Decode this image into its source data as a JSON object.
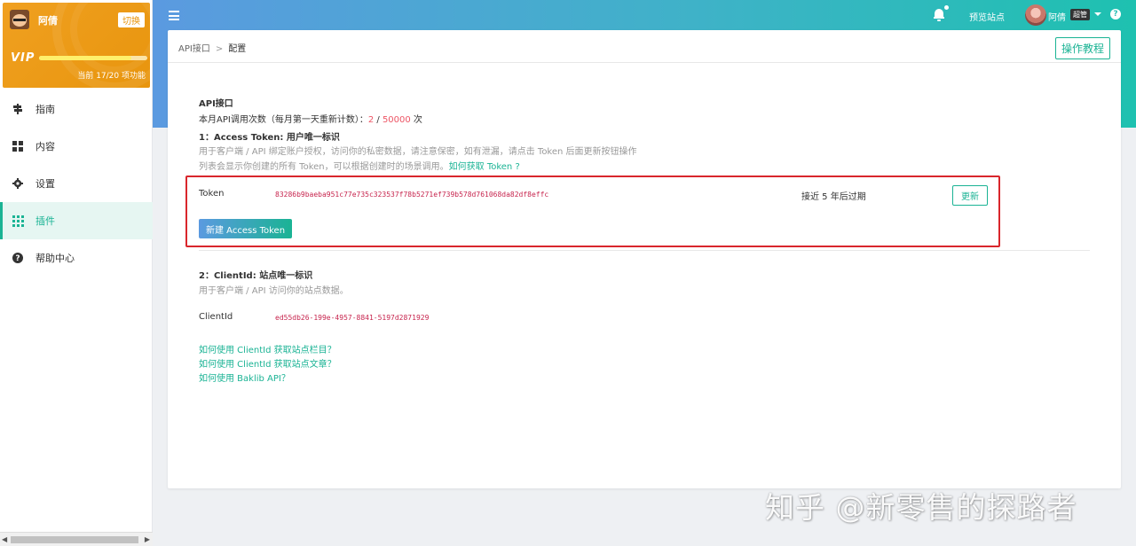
{
  "user_card": {
    "name": "阿倩",
    "switch_label": "切换",
    "vip_label": "VIP",
    "quota_text": "当前 17/20 项功能",
    "quota_fraction": 0.85
  },
  "nav": {
    "items": [
      {
        "label": "指南",
        "icon": "road-sign-icon"
      },
      {
        "label": "内容",
        "icon": "grid-icon"
      },
      {
        "label": "设置",
        "icon": "gear-icon"
      },
      {
        "label": "插件",
        "icon": "apps-icon",
        "active": true
      },
      {
        "label": "帮助中心",
        "icon": "question-icon"
      }
    ]
  },
  "topbar": {
    "preview_label": "预览站点",
    "user_name": "阿倩",
    "role_badge": "超管",
    "help_glyph": "?"
  },
  "panel": {
    "breadcrumb": [
      "API接口",
      ">",
      "配置"
    ],
    "tutorial_label": "操作教程"
  },
  "api": {
    "title": "API接口",
    "usage_prefix": "本月API调用次数（每月第一天重新计数）：",
    "usage_used": "2",
    "usage_sep": " / ",
    "usage_limit": "50000",
    "usage_suffix": " 次"
  },
  "access_token": {
    "title": "1：Access Token: 用户唯一标识",
    "desc_line1": "用于客户端 / API 绑定账户授权，访问你的私密数据，请注意保密，如有泄漏，请点击 Token 后面更新按钮操作",
    "desc_line2": "列表会显示你创建的所有 Token，可以根据创建时的场景调用。",
    "desc_link": "如何获取 Token ?",
    "label": "Token",
    "value": "83286b9baeba951c77e735c323537f78b5271ef739b578d761068da82df8effc",
    "expiry": "接近 5 年后过期",
    "renew_label": "更新",
    "new_label": "新建 Access Token"
  },
  "client_id": {
    "title": "2：ClientId: 站点唯一标识",
    "desc": "用于客户端 / API 访问你的站点数据。",
    "label": "ClientId",
    "value": "ed55db26-199e-4957-8841-5197d2871929"
  },
  "help_links": [
    "如何使用 ClientId 获取站点栏目？",
    "如何使用 ClientId 获取站点文章？",
    "如何使用 Baklib API？"
  ],
  "watermark": "知乎 @新零售的探路者",
  "colors": {
    "accent": "#1ab394",
    "vip_orange": "#e8950e",
    "danger": "#ed5565",
    "highlight_border": "#d9262c"
  }
}
